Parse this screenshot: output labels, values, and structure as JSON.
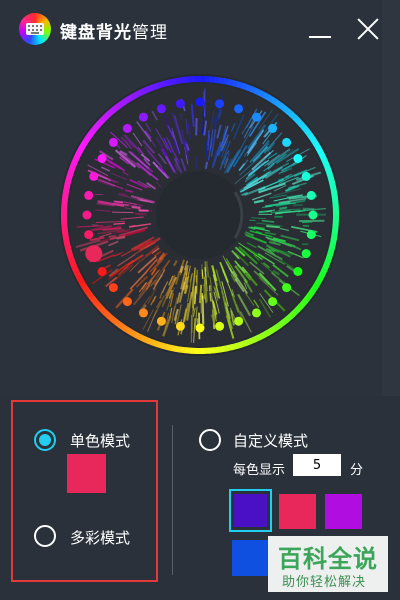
{
  "window": {
    "title_bold": "键盘背光",
    "title_normal": "管理",
    "logo_icon": "rainbow-keyboard-icon",
    "minimize_icon": "minimize-icon",
    "close_icon": "close-icon"
  },
  "color_wheel": {
    "selected_color": "#e8285a"
  },
  "modes": {
    "single": {
      "label": "单色模式",
      "selected": true,
      "swatch_color": "#e8285a"
    },
    "multi": {
      "label": "多彩模式",
      "selected": false
    },
    "custom": {
      "label": "自定义模式",
      "selected": false,
      "per_color_label": "每色显示",
      "per_color_value": "5",
      "unit": "分",
      "swatches": [
        "#4a10c4",
        "#e8285a",
        "#b00ee0",
        "#1050e0"
      ]
    }
  },
  "watermark": {
    "main": "百科全说",
    "sub": "助你轻松解决"
  },
  "colors": {
    "accent": "#22cdf0",
    "highlight_border": "#e23a3a",
    "background": "#2b323c"
  }
}
